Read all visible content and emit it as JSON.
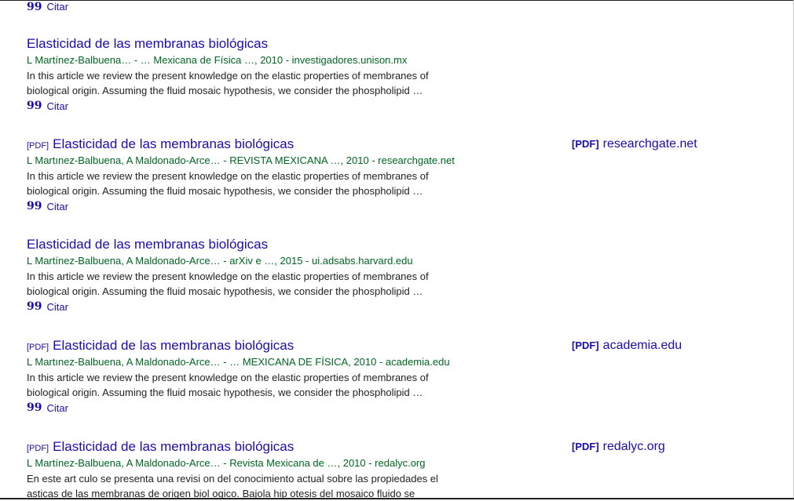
{
  "top_citar": {
    "label": "Citar"
  },
  "results": [
    {
      "badge": "",
      "title": "Elasticidad de las membranas biológicas",
      "meta": "L Martínez-Balbuena… - … Mexicana de Física …, 2010 - investigadores.unison.mx",
      "snippet_1": "In this article we review the present knowledge on the elastic properties of membranes of",
      "snippet_2": "biological origin. Assuming the fluid mosaic hypothesis, we consider the phospholipid …",
      "citar": "Citar"
    },
    {
      "badge": "[PDF]",
      "title": "Elasticidad de las membranas biológicas",
      "meta": "L Martınez-Balbuena, A Maldonado-Arce… - REVISTA MEXICANA …, 2010 - researchgate.net",
      "snippet_1": "In this article we review the present knowledge on the elastic properties of membranes of",
      "snippet_2": "biological origin. Assuming the fluid mosaic hypothesis, we consider the phospholipid …",
      "citar": "Citar",
      "side_badge": "[PDF]",
      "side_domain": "researchgate.net"
    },
    {
      "badge": "",
      "title": "Elasticidad de las membranas biológicas",
      "meta": "L Martínez-Balbuena, A Maldonado-Arce… - arXiv e …, 2015 - ui.adsabs.harvard.edu",
      "snippet_1": "In this article we review the present knowledge on the elastic properties of membranes of",
      "snippet_2": "biological origin. Assuming the fluid mosaic hypothesis, we consider the phospholipid …",
      "citar": "Citar"
    },
    {
      "badge": "[PDF]",
      "title": "Elasticidad de las membranas biológicas",
      "meta": "L Martınez-Balbuena, A Maldonado-Arce… - … MEXICANA DE FÍSICA, 2010 - academia.edu",
      "snippet_1": "In this article we review the present knowledge on the elastic properties of membranes of",
      "snippet_2": "biological origin. Assuming the fluid mosaic hypothesis, we consider the phospholipid …",
      "citar": "Citar",
      "side_badge": "[PDF]",
      "side_domain": "academia.edu"
    },
    {
      "badge": "[PDF]",
      "title": "Elasticidad de las membranas biológicas",
      "meta": "L Martínez-Balbuena, A Maldonado-Arce… - Revista Mexicana de …, 2010 - redalyc.org",
      "snippet_1": "En este art culo se presenta una revisi on del conocimiento actual sobre las propiedades el",
      "snippet_2": "asticas de las membranas de origen biol ogico. Bajola hip otesis del mosaico fluido se",
      "citar": "",
      "side_badge": "[PDF]",
      "side_domain": "redalyc.org"
    }
  ],
  "icons": {
    "citar": "quote-icon"
  }
}
